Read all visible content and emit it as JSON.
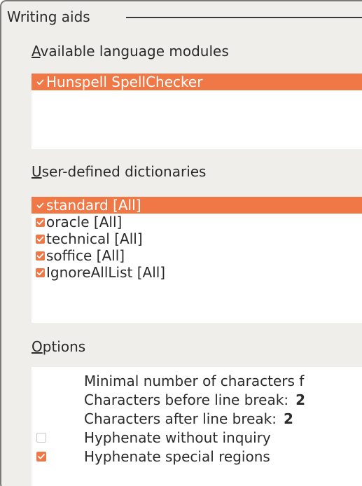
{
  "frame": {
    "title": "Writing aids"
  },
  "modules": {
    "label_mnemonic": "A",
    "label_rest": "vailable language modules",
    "items": [
      {
        "label": "Hunspell SpellChecker",
        "checked": true,
        "selected": true
      }
    ]
  },
  "dictionaries": {
    "label_mnemonic": "U",
    "label_rest": "ser-defined dictionaries",
    "items": [
      {
        "label": "standard [All]",
        "checked": true,
        "selected": true
      },
      {
        "label": "oracle [All]",
        "checked": true,
        "selected": false
      },
      {
        "label": "technical [All]",
        "checked": true,
        "selected": false
      },
      {
        "label": "soffice [All]",
        "checked": true,
        "selected": false
      },
      {
        "label": "IgnoreAllList [All]",
        "checked": true,
        "selected": false
      }
    ]
  },
  "options": {
    "label_mnemonic": "O",
    "label_rest": "ptions",
    "items": [
      {
        "label": "Minimal number of characters f",
        "value": "",
        "checkbox": false
      },
      {
        "label": "Characters before line break:",
        "value": "2",
        "checkbox": false
      },
      {
        "label": "Characters after line break:",
        "value": "2",
        "checkbox": false
      },
      {
        "label": "Hyphenate without inquiry",
        "value": "",
        "checkbox": true,
        "checked": false
      },
      {
        "label": "Hyphenate special regions",
        "value": "",
        "checkbox": true,
        "checked": true
      }
    ]
  },
  "colors": {
    "accent": "#f07746",
    "dialog_bg": "#efeeeb",
    "list_bg": "#ffffff"
  }
}
